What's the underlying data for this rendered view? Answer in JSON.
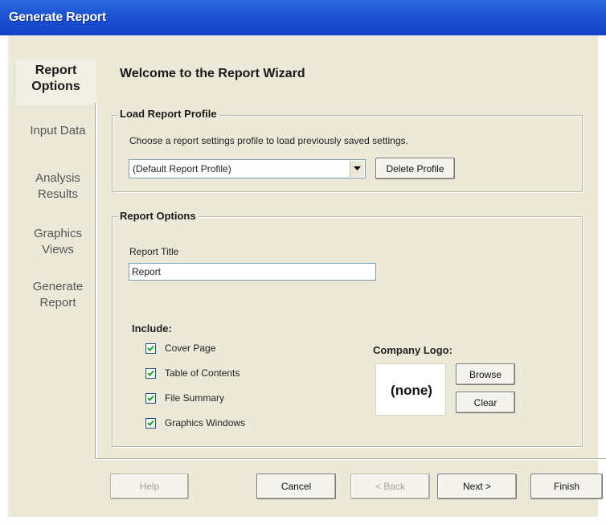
{
  "window": {
    "title": "Generate Report"
  },
  "nav": {
    "items": [
      {
        "label": "Report Options",
        "line1": "Report",
        "line2": "Options",
        "active": true
      },
      {
        "label": "Input Data",
        "line1": "Input Data",
        "line2": "",
        "active": false
      },
      {
        "label": "Analysis Results",
        "line1": "Analysis",
        "line2": "Results",
        "active": false
      },
      {
        "label": "Graphics Views",
        "line1": "Graphics",
        "line2": "Views",
        "active": false
      },
      {
        "label": "Generate Report",
        "line1": "Generate",
        "line2": "Report",
        "active": false
      }
    ]
  },
  "main": {
    "heading": "Welcome to the Report Wizard",
    "load_profile": {
      "legend": "Load Report Profile",
      "description": "Choose a report settings profile to load previously saved settings.",
      "profile_select": {
        "value": "(Default Report Profile)"
      },
      "delete_button": "Delete Profile"
    },
    "report_options": {
      "legend": "Report Options",
      "title_label": "Report Title",
      "title_value": "Report",
      "include_label": "Include:",
      "checkboxes": [
        {
          "label": "Cover Page",
          "checked": true
        },
        {
          "label": "Table of Contents",
          "checked": true
        },
        {
          "label": "File Summary",
          "checked": true
        },
        {
          "label": "Graphics Windows",
          "checked": true
        }
      ],
      "company_logo": {
        "label": "Company Logo:",
        "value": "(none)",
        "browse_button": "Browse",
        "clear_button": "Clear"
      }
    }
  },
  "footer": {
    "help": {
      "label": "Help",
      "enabled": false
    },
    "cancel": {
      "label": "Cancel",
      "enabled": true
    },
    "back": {
      "label": "< Back",
      "enabled": false
    },
    "next": {
      "label": "Next >",
      "enabled": true
    },
    "finish": {
      "label": "Finish",
      "enabled": true
    }
  },
  "colors": {
    "titlebar": "#1d54d6",
    "dialog_bg": "#ece9d8",
    "border_blue": "#7f9db9"
  }
}
